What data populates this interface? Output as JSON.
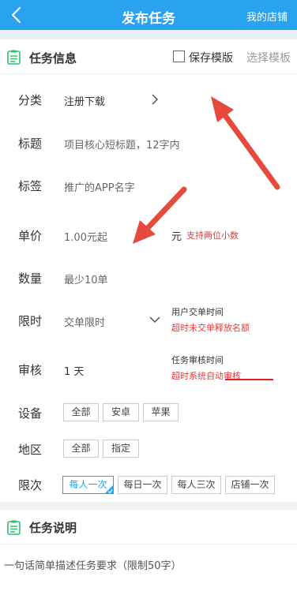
{
  "header": {
    "title": "发布任务",
    "shop": "我的店铺"
  },
  "task_info": {
    "title": "任务信息",
    "save_template": "保存模版",
    "select_template": "选择模板"
  },
  "form": {
    "category": {
      "label": "分类",
      "value": "注册下载"
    },
    "title": {
      "label": "标题",
      "placeholder": "项目核心短标题，12字内"
    },
    "tag": {
      "label": "标签",
      "placeholder": "推广的APP名字"
    },
    "price": {
      "label": "单价",
      "placeholder": "1.00元起",
      "unit": "元",
      "hint": "支持两位小数"
    },
    "quantity": {
      "label": "数量",
      "placeholder": "最少10单"
    },
    "time_limit": {
      "label": "限时",
      "placeholder": "交单限时",
      "hint_title": "用户交单时间",
      "hint_red": "超时未交单释放名额"
    },
    "review": {
      "label": "审核",
      "value": "1 天",
      "hint_title": "任务审核时间",
      "hint_red": "超时系统自动审核"
    },
    "device": {
      "label": "设备",
      "options": [
        "全部",
        "安卓",
        "苹果"
      ]
    },
    "region": {
      "label": "地区",
      "options": [
        "全部",
        "指定"
      ]
    },
    "limit": {
      "label": "限次",
      "options": [
        "每人一次",
        "每日一次",
        "每人三次",
        "店铺一次"
      ],
      "selected": "每人一次"
    }
  },
  "task_desc": {
    "title": "任务说明",
    "placeholder": "一句话简单描述任务要求（限制50字）"
  },
  "colors": {
    "accent": "#29a3ef",
    "hint_red": "#e23b3b",
    "annotation_arrow": "#e64a3c",
    "icon_green": "#2fbf71"
  }
}
